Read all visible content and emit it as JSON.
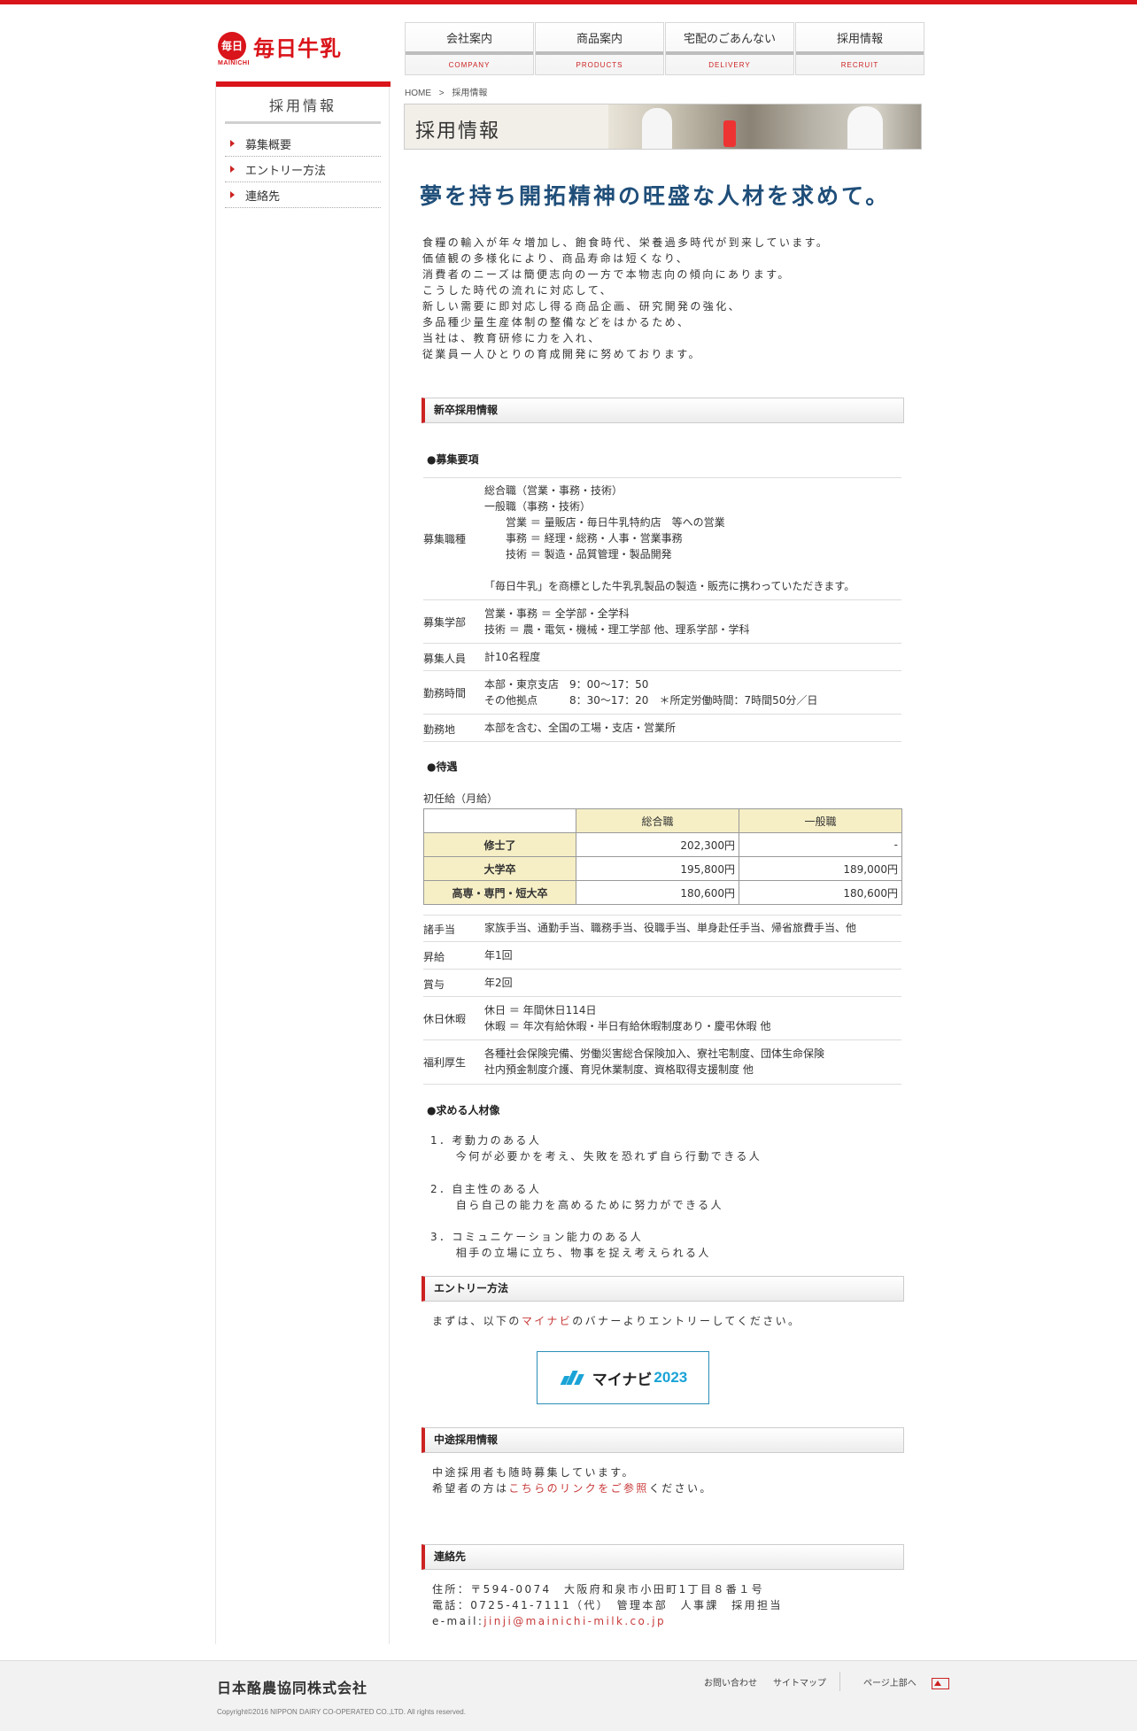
{
  "brand": {
    "logo_mark": "毎日",
    "logo_sub": "MAINICHI",
    "logo_text": "毎日牛乳",
    "accent_color": "#d9141a"
  },
  "gnav": [
    {
      "jp": "会社案内",
      "en": "COMPANY"
    },
    {
      "jp": "商品案内",
      "en": "PRODUCTS"
    },
    {
      "jp": "宅配のごあんない",
      "en": "DELIVERY"
    },
    {
      "jp": "採用情報",
      "en": "RECRUIT"
    }
  ],
  "sidebar": {
    "title": "採用情報",
    "items": [
      {
        "label": "募集概要"
      },
      {
        "label": "エントリー方法"
      },
      {
        "label": "連絡先"
      }
    ]
  },
  "breadcrumb": {
    "home": "HOME",
    "sep": ">",
    "current": "採用情報"
  },
  "hero": {
    "title": "採用情報"
  },
  "catch": "夢を持ち開拓精神の旺盛な人材を求めて。",
  "intro": [
    "食糧の輸入が年々増加し、飽食時代、栄養過多時代が到来しています。",
    "価値観の多様化により、商品寿命は短くなり、",
    "消費者のニーズは簡便志向の一方で本物志向の傾向にあります。",
    "こうした時代の流れに対応して、",
    "新しい需要に即対応し得る商品企画、研究開発の強化、",
    "多品種少量生産体制の整備などをはかるため、",
    "当社は、教育研修に力を入れ、",
    "従業員一人ひとりの育成開発に努めております。"
  ],
  "new_grad": {
    "heading": "新卒採用情報",
    "req_heading": "●募集要項",
    "rows": [
      {
        "label": "募集職種",
        "value": "総合職（営業・事務・技術）\n一般職（事務・技術）\n　　営業 ＝ 量販店・毎日牛乳特約店　等への営業\n　　事務 ＝ 経理・総務・人事・営業事務\n　　技術 ＝ 製造・品質管理・製品開発\n\n「毎日牛乳」を商標とした牛乳乳製品の製造・販売に携わっていただきます。"
      },
      {
        "label": "募集学部",
        "value": "営業・事務 ＝ 全学部・全学科\n技術 ＝ 農・電気・機械・理工学部 他、理系学部・学科"
      },
      {
        "label": "募集人員",
        "value": "計10名程度"
      },
      {
        "label": "勤務時間",
        "value": "本部・東京支店　9：00～17：50\nその他拠点　　　8：30～17：20　＊所定労働時間：7時間50分／日"
      },
      {
        "label": "勤務地",
        "value": "本部を含む、全国の工場・支店・営業所"
      }
    ],
    "treat_heading": "●待遇",
    "salary_caption": "初任給（月給）",
    "salary_cols": [
      "総合職",
      "一般職"
    ],
    "salary_rows": [
      {
        "label": "修士了",
        "v1": "202,300円",
        "v2": "-"
      },
      {
        "label": "大学卒",
        "v1": "195,800円",
        "v2": "189,000円"
      },
      {
        "label": "高専・専門・短大卒",
        "v1": "180,600円",
        "v2": "180,600円"
      }
    ],
    "benefit_rows": [
      {
        "label": "諸手当",
        "value": "家族手当、通勤手当、職務手当、役職手当、単身赴任手当、帰省旅費手当、他"
      },
      {
        "label": "昇給",
        "value": "年1回"
      },
      {
        "label": "賞与",
        "value": "年2回"
      },
      {
        "label": "休日休暇",
        "value": "休日 ＝ 年間休日114日\n休暇 ＝ 年次有給休暇・半日有給休暇制度あり・慶弔休暇 他"
      },
      {
        "label": "福利厚生",
        "value": "各種社会保険完備、労働災害総合保険加入、寮社宅制度、団体生命保険\n社内預金制度介護、育児休業制度、資格取得支援制度 他"
      }
    ],
    "ideal_heading": "●求める人材像",
    "ideal": [
      "1．考動力のある人\n　　今何が必要かを考え、失敗を恐れず自ら行動できる人",
      "2．自主性のある人\n　　自ら自己の能力を高めるために努力ができる人",
      "3．コミュニケーション能力のある人\n　　相手の立場に立ち、物事を捉え考えられる人"
    ]
  },
  "entry": {
    "heading": "エントリー方法",
    "text_before": "まずは、以下の",
    "link": "マイナビ",
    "text_after": "のバナーよりエントリーしてください。",
    "banner_text": "マイナビ",
    "banner_year": "2023",
    "banner_color": "#1aa3d6"
  },
  "mid_career": {
    "heading": "中途採用情報",
    "line1": "中途採用者も随時募集しています。",
    "line2_before": "希望者の方は",
    "line2_link": "こちらのリンクをご参照",
    "line2_after": "ください。"
  },
  "contact": {
    "heading": "連絡先",
    "address": "住所：〒594-0074　大阪府和泉市小田町1丁目８番１号",
    "phone": "電話：0725-41-7111（代）　管理本部　人事課　採用担当",
    "email_label": "e-mail:",
    "email": "jinji@mainichi-milk.co.jp"
  },
  "footer": {
    "company": "日本酪農協同株式会社",
    "copyright": "Copyright©2016 NIPPON DAIRY CO-OPERATED CO.,LTD. All rights reserved.",
    "links": [
      "お問い合わせ",
      "サイトマップ"
    ],
    "pagetop": "ページ上部へ"
  }
}
